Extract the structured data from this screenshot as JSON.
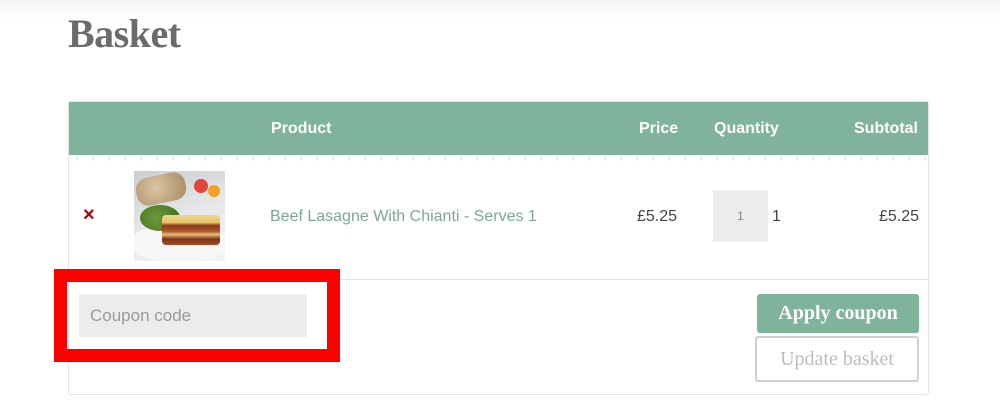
{
  "page": {
    "title": "Basket"
  },
  "table": {
    "headers": {
      "product": "Product",
      "price": "Price",
      "quantity": "Quantity",
      "subtotal": "Subtotal"
    },
    "colors": {
      "header_bg": "#80b39b",
      "link": "#7aa990",
      "remove": "#b00000"
    }
  },
  "items": [
    {
      "remove_icon": "×",
      "image": "lasagne-thumbnail",
      "name": "Beef Lasagne With Chianti - Serves 1",
      "price": "£5.25",
      "quantity_input": "1",
      "quantity_display": "1",
      "subtotal": "£5.25"
    }
  ],
  "coupon": {
    "placeholder": "Coupon code",
    "value": ""
  },
  "actions": {
    "apply_label": "Apply coupon",
    "update_label": "Update basket"
  },
  "annotation": {
    "color": "#ff0000",
    "target": "coupon-input"
  }
}
